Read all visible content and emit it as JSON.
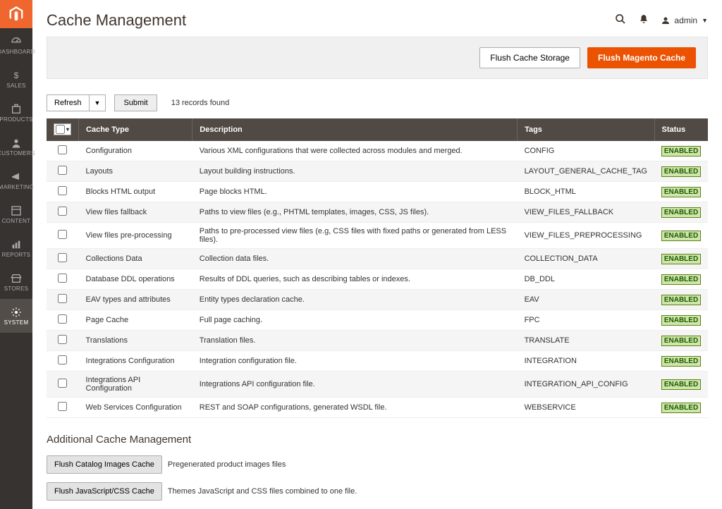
{
  "page": {
    "title": "Cache Management"
  },
  "header": {
    "admin_label": "admin"
  },
  "sidenav": {
    "items": [
      {
        "label": "DASHBOARD",
        "name": "dashboard"
      },
      {
        "label": "SALES",
        "name": "sales"
      },
      {
        "label": "PRODUCTS",
        "name": "products"
      },
      {
        "label": "CUSTOMERS",
        "name": "customers"
      },
      {
        "label": "MARKETING",
        "name": "marketing"
      },
      {
        "label": "CONTENT",
        "name": "content"
      },
      {
        "label": "REPORTS",
        "name": "reports"
      },
      {
        "label": "STORES",
        "name": "stores"
      },
      {
        "label": "SYSTEM",
        "name": "system",
        "active": true
      }
    ]
  },
  "actions": {
    "flush_storage": "Flush Cache Storage",
    "flush_magento": "Flush Magento Cache"
  },
  "toolbar": {
    "refresh": "Refresh",
    "submit": "Submit",
    "records": "13 records found"
  },
  "table": {
    "headers": {
      "cache_type": "Cache Type",
      "description": "Description",
      "tags": "Tags",
      "status": "Status"
    },
    "rows": [
      {
        "type": "Configuration",
        "desc": "Various XML configurations that were collected across modules and merged.",
        "tags": "CONFIG",
        "status": "ENABLED"
      },
      {
        "type": "Layouts",
        "desc": "Layout building instructions.",
        "tags": "LAYOUT_GENERAL_CACHE_TAG",
        "status": "ENABLED"
      },
      {
        "type": "Blocks HTML output",
        "desc": "Page blocks HTML.",
        "tags": "BLOCK_HTML",
        "status": "ENABLED"
      },
      {
        "type": "View files fallback",
        "desc": "Paths to view files (e.g., PHTML templates, images, CSS, JS files).",
        "tags": "VIEW_FILES_FALLBACK",
        "status": "ENABLED"
      },
      {
        "type": "View files pre-processing",
        "desc": "Paths to pre-processed view files (e.g, CSS files with fixed paths or generated from LESS files).",
        "tags": "VIEW_FILES_PREPROCESSING",
        "status": "ENABLED"
      },
      {
        "type": "Collections Data",
        "desc": "Collection data files.",
        "tags": "COLLECTION_DATA",
        "status": "ENABLED"
      },
      {
        "type": "Database DDL operations",
        "desc": "Results of DDL queries, such as describing tables or indexes.",
        "tags": "DB_DDL",
        "status": "ENABLED"
      },
      {
        "type": "EAV types and attributes",
        "desc": "Entity types declaration cache.",
        "tags": "EAV",
        "status": "ENABLED"
      },
      {
        "type": "Page Cache",
        "desc": "Full page caching.",
        "tags": "FPC",
        "status": "ENABLED"
      },
      {
        "type": "Translations",
        "desc": "Translation files.",
        "tags": "TRANSLATE",
        "status": "ENABLED"
      },
      {
        "type": "Integrations Configuration",
        "desc": "Integration configuration file.",
        "tags": "INTEGRATION",
        "status": "ENABLED"
      },
      {
        "type": "Integrations API Configuration",
        "desc": "Integrations API configuration file.",
        "tags": "INTEGRATION_API_CONFIG",
        "status": "ENABLED"
      },
      {
        "type": "Web Services Configuration",
        "desc": "REST and SOAP configurations, generated WSDL file.",
        "tags": "WEBSERVICE",
        "status": "ENABLED"
      }
    ]
  },
  "additional": {
    "title": "Additional Cache Management",
    "items": [
      {
        "button": "Flush Catalog Images Cache",
        "desc": "Pregenerated product images files"
      },
      {
        "button": "Flush JavaScript/CSS Cache",
        "desc": "Themes JavaScript and CSS files combined to one file."
      }
    ]
  }
}
